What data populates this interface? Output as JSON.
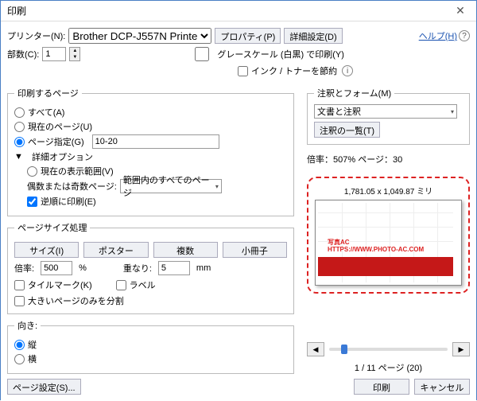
{
  "title": "印刷",
  "printer": {
    "label": "プリンター(N):",
    "value": "Brother DCP-J557N Printer",
    "prop_btn": "プロパティ(P)",
    "adv_btn": "詳細設定(D)",
    "help": "ヘルプ(H)"
  },
  "copies": {
    "label": "部数(C):",
    "value": "1"
  },
  "grayscale": "グレースケール (白黒) で印刷(Y)",
  "saveink": "インク / トナーを節約",
  "pages": {
    "legend": "印刷するページ",
    "all": "すべて(A)",
    "current": "現在のページ(U)",
    "range": "ページ指定(G)",
    "range_value": "10-20",
    "more": "詳細オプション",
    "view": "現在の表示範囲(V)",
    "odd_even_label": "偶数または奇数ページ:",
    "odd_even_value": "範囲内のすべてのページ",
    "reverse": "逆順に印刷(E)"
  },
  "sizing": {
    "legend": "ページサイズ処理",
    "size_btn": "サイズ(I)",
    "poster_btn": "ポスター",
    "multiple_btn": "複数",
    "booklet_btn": "小冊子",
    "scale_label": "倍率:",
    "scale_value": "500",
    "scale_pct": "%",
    "overlap_label": "重なり:",
    "overlap_value": "5",
    "overlap_unit": "mm",
    "tile_marks": "タイルマーク(K)",
    "labels": "ラベル",
    "large_only": "大きいページのみを分割"
  },
  "orient": {
    "legend": "向き:",
    "portrait": "縦",
    "landscape": "横"
  },
  "annot": {
    "legend": "注釈とフォーム(M)",
    "value": "文書と注釈",
    "summary_btn": "注釈の一覧(T)"
  },
  "preview": {
    "status": "倍率：507% ページ：30",
    "size": "1,781.05 x 1,049.87 ミリ",
    "watermark1": "写真AC",
    "watermark2": "HTTPS://WWW.PHOTO-AC.COM",
    "pageinfo": "1 / 11 ページ (20)"
  },
  "footer": {
    "page_setup": "ページ設定(S)...",
    "print": "印刷",
    "cancel": "キャンセル"
  }
}
